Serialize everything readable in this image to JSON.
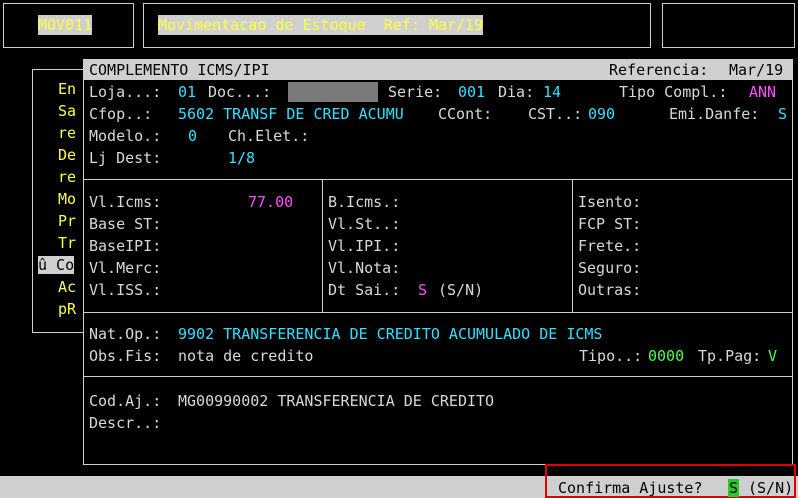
{
  "header": {
    "program_code": "MOV011",
    "title": "Movimentacao de Estoque  Ref: Mar/19"
  },
  "menu": {
    "items": [
      "En",
      "Sa",
      "re",
      "De",
      "re",
      "Mo",
      "Pr",
      "Tr",
      "û Co",
      "Ac",
      "pR"
    ]
  },
  "dialog": {
    "title": "COMPLEMENTO ICMS/IPI",
    "referencia_label": "Referencia:",
    "referencia_value": "Mar/19",
    "loja_label": "Loja...:",
    "loja_value": "01",
    "doc_label": "Doc...:",
    "doc_value": "",
    "serie_label": "Serie:",
    "serie_value": "001",
    "dia_label": "Dia:",
    "dia_value": "14",
    "tipo_compl_label": "Tipo Compl.:",
    "tipo_compl_value": "ANN",
    "cfop_label": "Cfop..:",
    "cfop_value": "5602 TRANSF DE CRED ACUMU",
    "ccont_label": "CCont:",
    "cst_label": "CST..:",
    "cst_value": "090",
    "emi_danfe_label": "Emi.Danfe:",
    "emi_danfe_value": "S",
    "modelo_label": "Modelo.:",
    "modelo_value": "0",
    "ch_elet_label": "Ch.Elet.:",
    "lj_dest_label": "Lj Dest:",
    "lj_dest_value": "1/8",
    "col1": {
      "vl_icms_label": "Vl.Icms:",
      "vl_icms_value": "77.00",
      "base_st_label": "Base ST:",
      "base_ipi_label": "BaseIPI:",
      "vl_merc_label": "Vl.Merc:",
      "vl_iss_label": "Vl.ISS.:"
    },
    "col2": {
      "b_icms_label": "B.Icms.:",
      "vl_st_label": "Vl.St..:",
      "vl_ipi_label": "Vl.IPI.:",
      "vl_nota_label": "Vl.Nota:",
      "dt_sai_label": "Dt Sai.:",
      "dt_sai_value": "S",
      "dt_sai_hint": "(S/N)"
    },
    "col3": {
      "isento_label": "Isento:",
      "fcp_st_label": "FCP ST:",
      "frete_label": "Frete.:",
      "seguro_label": "Seguro:",
      "outras_label": "Outras:"
    },
    "nat_op_label": "Nat.Op.:",
    "nat_op_value": "9902 TRANSFERENCIA DE CREDITO ACUMULADO DE ICMS",
    "obs_fis_label": "Obs.Fis:",
    "obs_fis_value": "nota de credito",
    "tipo_label": "Tipo..:",
    "tipo_value": "0000",
    "tp_pag_label": "Tp.Pag:",
    "tp_pag_value": "V",
    "cod_aj_label": "Cod.Aj.:",
    "cod_aj_value": "MG00990002 TRANSFERENCIA DE CREDITO",
    "descr_label": "Descr..:"
  },
  "prompt": {
    "text": "Confirma Ajuste?",
    "value": "S",
    "hint": "(S/N)"
  },
  "colors": {
    "accent_cyan": "#33e0ff",
    "accent_magenta": "#ff50ff",
    "accent_green": "#4cff4c",
    "title_yellow": "#ffff40",
    "prompt_border": "#e00000"
  }
}
